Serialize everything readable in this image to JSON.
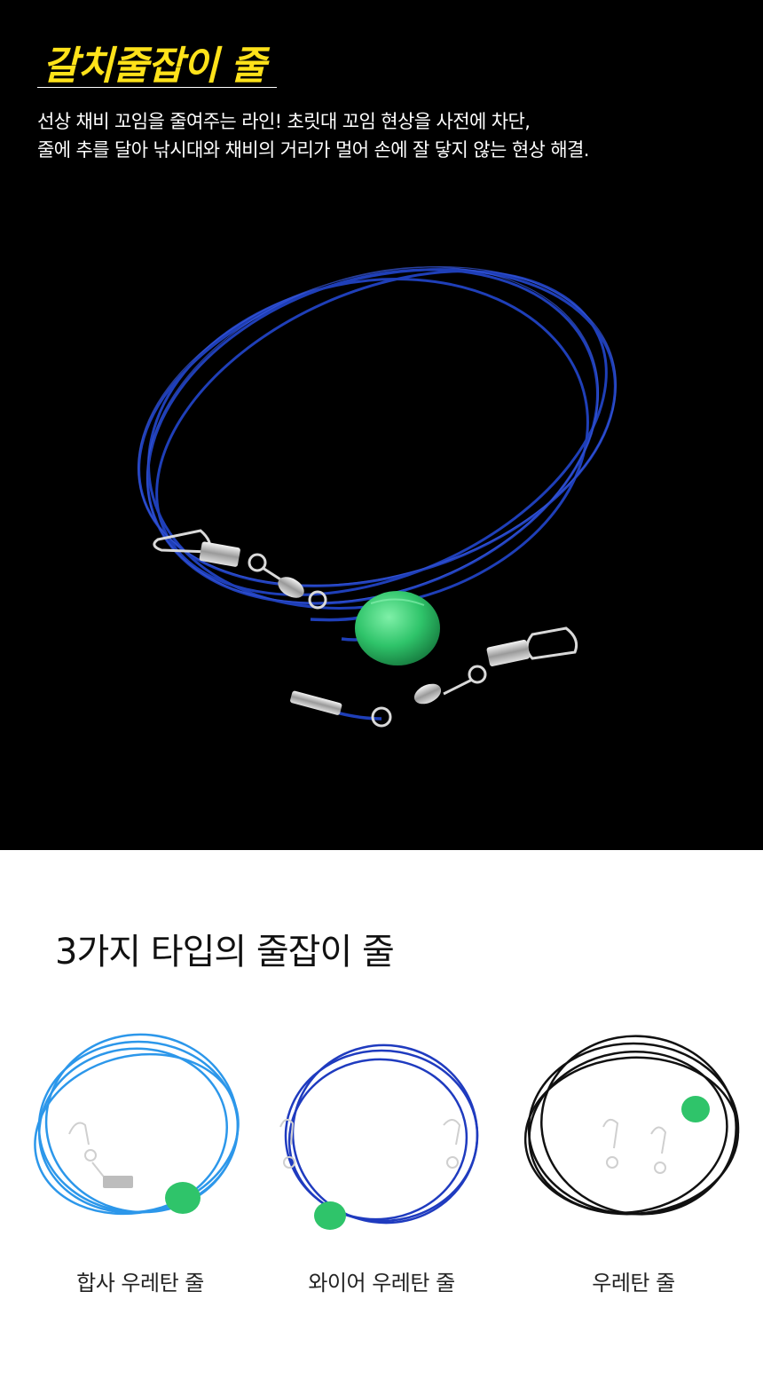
{
  "hero": {
    "title": "갈치줄잡이 줄",
    "description_lines": [
      "선상 채비 꼬임을 줄여주는 라인! 초릿대 꼬임 현상을 사전에 차단,",
      "줄에 추를 달아 낚시대와 채비의 거리가 멀어 손에 잘 닿지 않는 현상 해결."
    ],
    "title_color": "#ffe21a",
    "line_color": "#1f3fb8",
    "bead_color": "#2fc46a"
  },
  "types": {
    "title": "3가지 타입의 줄잡이 줄",
    "items": [
      {
        "label": "합사 우레탄 줄",
        "line_color": "#2c97ea"
      },
      {
        "label": "와이어 우레탄 줄",
        "line_color": "#1f3bbf"
      },
      {
        "label": "우레탄 줄",
        "line_color": "#111111"
      }
    ]
  }
}
